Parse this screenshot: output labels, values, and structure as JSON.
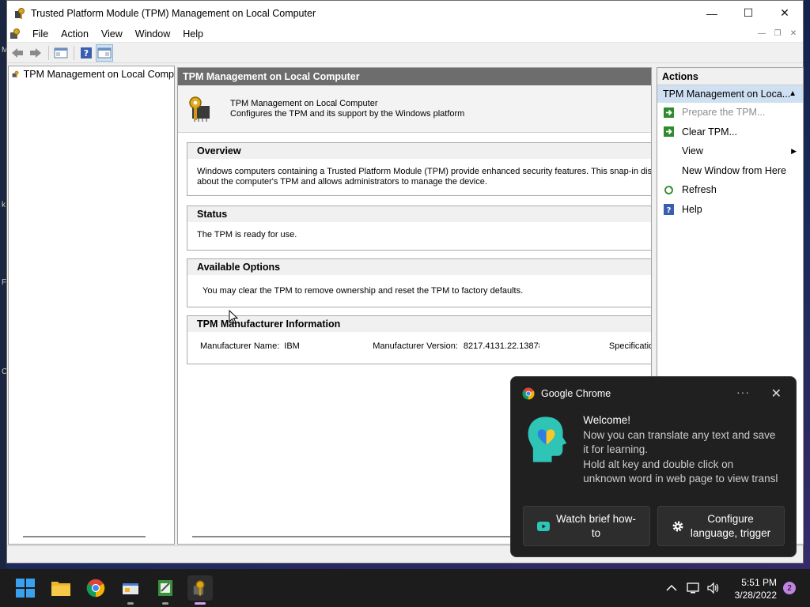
{
  "window": {
    "title": "Trusted Platform Module (TPM) Management on Local Computer",
    "controls": {
      "minimize": "—",
      "maximize": "☐",
      "close": "✕"
    }
  },
  "menu": {
    "items": [
      "File",
      "Action",
      "View",
      "Window",
      "Help"
    ]
  },
  "toolbar": {
    "icons": [
      "back-icon",
      "forward-icon",
      "show-hide-tree-icon",
      "help-icon",
      "show-hide-action-pane-icon"
    ]
  },
  "desktop": {
    "edge_letters": [
      "M",
      "k",
      "F",
      "C"
    ]
  },
  "tree": {
    "root_label": "TPM Management on Local Comp"
  },
  "center": {
    "header": "TPM Management on Local Computer",
    "banner_title": "TPM Management on Local Computer",
    "banner_subtitle": "Configures the TPM and its support by the Windows platform",
    "overview": {
      "heading": "Overview",
      "line1": "Windows computers containing a Trusted Platform Module (TPM) provide enhanced security features. This snap-in displays",
      "line2": "about the computer's TPM and allows administrators to manage the device."
    },
    "status": {
      "heading": "Status",
      "text": "The TPM is ready for use."
    },
    "options": {
      "heading": "Available Options",
      "text": "You may clear the TPM to remove ownership and reset the TPM to factory defaults."
    },
    "manufacturer": {
      "heading": "TPM Manufacturer Information",
      "name_label": "Manufacturer Name:",
      "name_value": "IBM",
      "version_label": "Manufacturer Version:",
      "version_value": "8217.4131.22.13878",
      "spec_label": "Specification"
    }
  },
  "actions": {
    "heading": "Actions",
    "group": "TPM Management on Loca...",
    "items": [
      {
        "label": "Prepare the TPM...",
        "disabled": true
      },
      {
        "label": "Clear TPM...",
        "disabled": false
      },
      {
        "label": "View",
        "disabled": false
      },
      {
        "label": "New Window from Here",
        "disabled": false
      },
      {
        "label": "Refresh",
        "disabled": false
      },
      {
        "label": "Help",
        "disabled": false
      }
    ]
  },
  "toast": {
    "app": "Google Chrome",
    "more": "···",
    "close": "✕",
    "welcome": "Welcome!",
    "line1": "Now you can translate any text and save",
    "line2": "it for learning.",
    "line3": "Hold alt key and double click on",
    "line4": "unknown word in web page to view transl",
    "button1_line1": "Watch brief how-",
    "button1_line2": "to",
    "button2_line1": "Configure",
    "button2_line2": "language, trigger"
  },
  "taskbar": {
    "time": "5:51 PM",
    "date": "3/28/2022",
    "notifications": "2"
  },
  "colors": {
    "center_header_bg": "#6d6d6d",
    "actions_group_bg": "#cfe0f2",
    "toast_bg": "#202020",
    "taskbar_bg": "#1c1c1c",
    "accent_blue": "#0a63c8"
  }
}
